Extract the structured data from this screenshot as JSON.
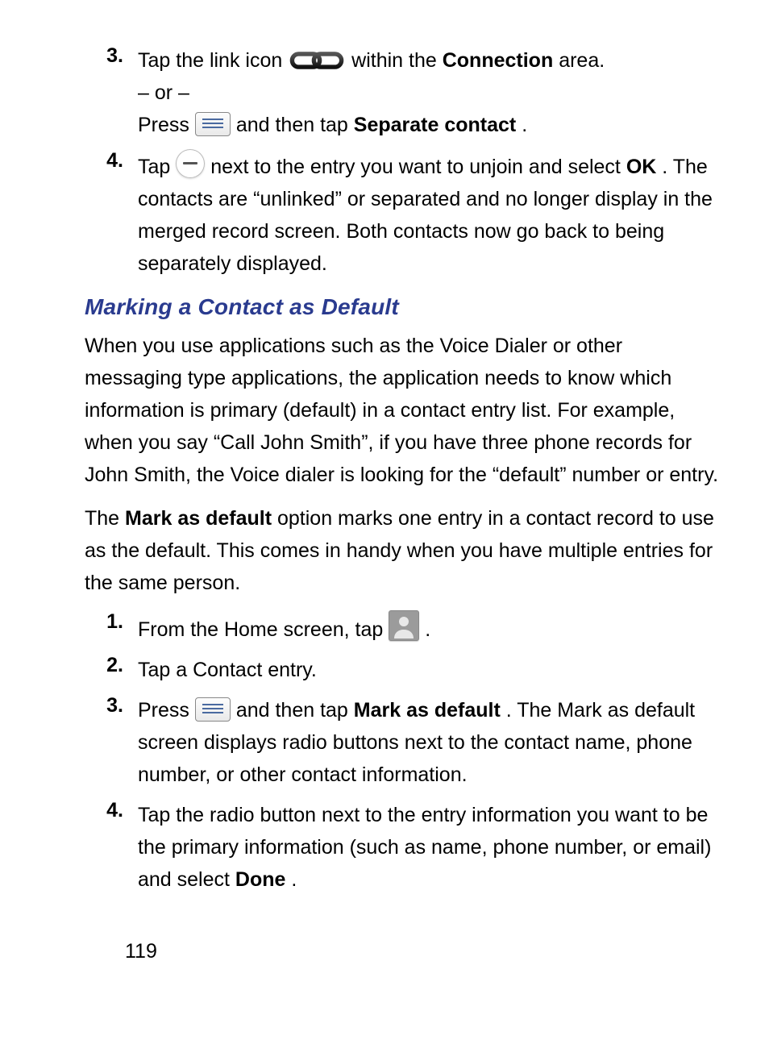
{
  "first_list": {
    "items": [
      {
        "num": "3.",
        "p1a": "Tap the link icon ",
        "p1b": " within the ",
        "p1c": "Connection",
        "p1d": " area.",
        "or_line": "– or –",
        "p2a": "Press ",
        "p2b": " and then tap ",
        "p2c": "Separate contact",
        "p2d": "."
      },
      {
        "num": "4.",
        "p1a": "Tap ",
        "p1b": " next to the entry you want to unjoin and select ",
        "p1c": "OK",
        "p1d": ". The contacts are “unlinked” or separated and no longer display in the merged record screen. Both contacts now go back to being separately displayed."
      }
    ]
  },
  "section_heading": "Marking a Contact as Default",
  "para1": "When you use applications such as the Voice Dialer or other messaging type applications, the application needs to know which information is primary (default) in a contact entry list. For example, when you say “Call John Smith”, if you have three phone records for John Smith, the Voice dialer is looking for the “default” number or entry.",
  "para2a": "The ",
  "para2b": "Mark as default",
  "para2c": " option marks one entry in a contact record to use as the default. This comes in handy when you have multiple entries for the same person.",
  "second_list": {
    "items": [
      {
        "num": "1.",
        "t1": "From the Home screen, tap ",
        "t2": "."
      },
      {
        "num": "2.",
        "t1": "Tap a Contact entry."
      },
      {
        "num": "3.",
        "t1": "Press ",
        "t2": " and then tap ",
        "t3": "Mark as default",
        "t4": ". The Mark as default screen displays radio buttons next to the contact name, phone number, or other contact information."
      },
      {
        "num": "4.",
        "t1": "Tap the radio button next to the entry information you want to be the primary information (such as name, phone number, or email) and select ",
        "t2": "Done",
        "t3": "."
      }
    ]
  },
  "page_number": "119"
}
